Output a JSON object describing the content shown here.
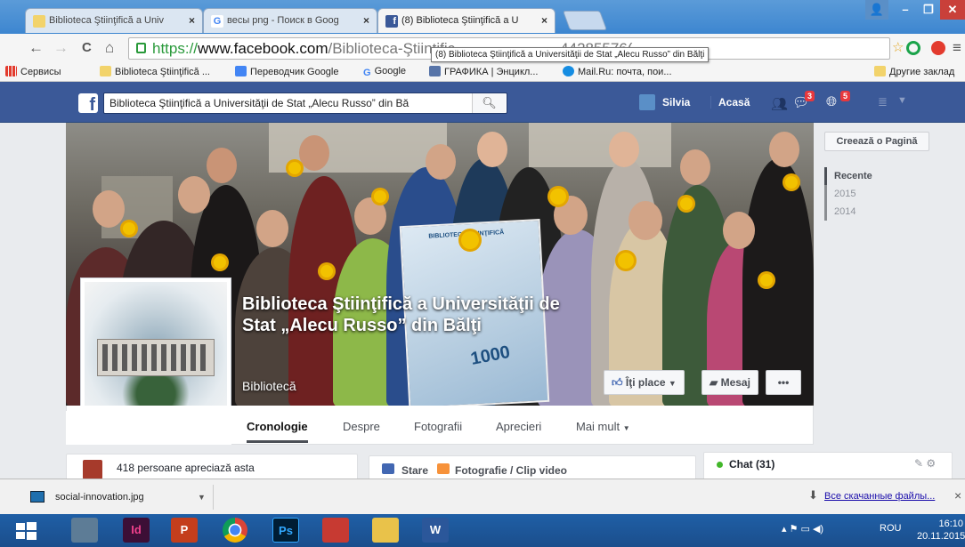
{
  "browser": {
    "tabs": [
      {
        "title": "Biblioteca Ştiinţifică a Univ",
        "icon": "bookmark-folder-icon",
        "close": "×"
      },
      {
        "title": "весы png - Поиск в Goog",
        "icon": "google-icon",
        "close": "×"
      },
      {
        "title": "(8) Biblioteca Ştiinţifică a U",
        "icon": "facebook-icon",
        "close": "×"
      }
    ],
    "window_controls": {
      "user": "👤",
      "minimize": "–",
      "maximize": "❐",
      "close": "✕"
    },
    "nav": {
      "back": "←",
      "forward": "→",
      "reload": "C",
      "home": "⌂"
    },
    "url": {
      "https": "https://",
      "domain": "www.facebook.com",
      "path": "/Biblioteca-Ştiinţific",
      "tail": "44285576("
    },
    "url_tooltip": "(8) Biblioteca Ştiinţifică a Universităţii de Stat „Alecu Russo” din Bălţi",
    "bookmarks": [
      {
        "label": "Сервисы",
        "icon": "apps-icon"
      },
      {
        "label": "Biblioteca Ştiinţifică ...",
        "icon": "bookmark-folder-icon"
      },
      {
        "label": "Переводчик Google",
        "icon": "translate-icon"
      },
      {
        "label": "Google",
        "icon": "google-icon"
      },
      {
        "label": "ГРАФИКА | Энцикл...",
        "icon": "encyclopedia-icon"
      },
      {
        "label": "Mail.Ru: почта, пои...",
        "icon": "mailru-icon"
      },
      {
        "label": "Другие заклад",
        "icon": "folder-icon"
      }
    ]
  },
  "facebook": {
    "search_value": "Biblioteca Ştiinţifică a Universităţii de Stat „Alecu Russo” din Bă",
    "user_name": "Silvia",
    "home_label": "Acasă",
    "badges": {
      "messages": "3",
      "notifications": "5"
    },
    "page": {
      "title": "Biblioteca Ştiinţifică a Universităţii de Stat „Alecu Russo” din Bălţi",
      "category": "Bibliotecă",
      "like_button": "Îţi place",
      "message_button": "Mesaj",
      "more_button": "•••",
      "tabs": [
        "Cronologie",
        "Despre",
        "Fotografii",
        "Aprecieri",
        "Mai mult"
      ],
      "banner_text": "1000",
      "banner_label": "BIBLIOTECA ŞTIINŢIFICĂ"
    },
    "side": {
      "create_page": "Creează o Pagină",
      "years": [
        "Recente",
        "2015",
        "2014"
      ]
    },
    "likes_text": "418 persoane apreciază asta",
    "composer": {
      "status": "Stare",
      "photo": "Fotografie / Clip video"
    },
    "chat_label": "Chat (31)"
  },
  "downloads": {
    "file_name": "social-innovation.jpg",
    "show_all": "Все скачанные файлы...",
    "close": "×"
  },
  "taskbar": {
    "apps": [
      {
        "name": "windows-start",
        "label": ""
      },
      {
        "name": "calculator",
        "label": ""
      },
      {
        "name": "indesign",
        "label": "Id"
      },
      {
        "name": "powerpoint",
        "label": "P"
      },
      {
        "name": "chrome",
        "label": ""
      },
      {
        "name": "photoshop",
        "label": "Ps"
      },
      {
        "name": "camera",
        "label": ""
      },
      {
        "name": "explorer",
        "label": ""
      },
      {
        "name": "word",
        "label": "W"
      }
    ],
    "language": "ROU",
    "time": "16:10",
    "date": "20.11.2015"
  },
  "colors": {
    "facebook_blue": "#3b5998",
    "accent_red": "#e8383d",
    "taskbar": "#1f5fa6"
  }
}
